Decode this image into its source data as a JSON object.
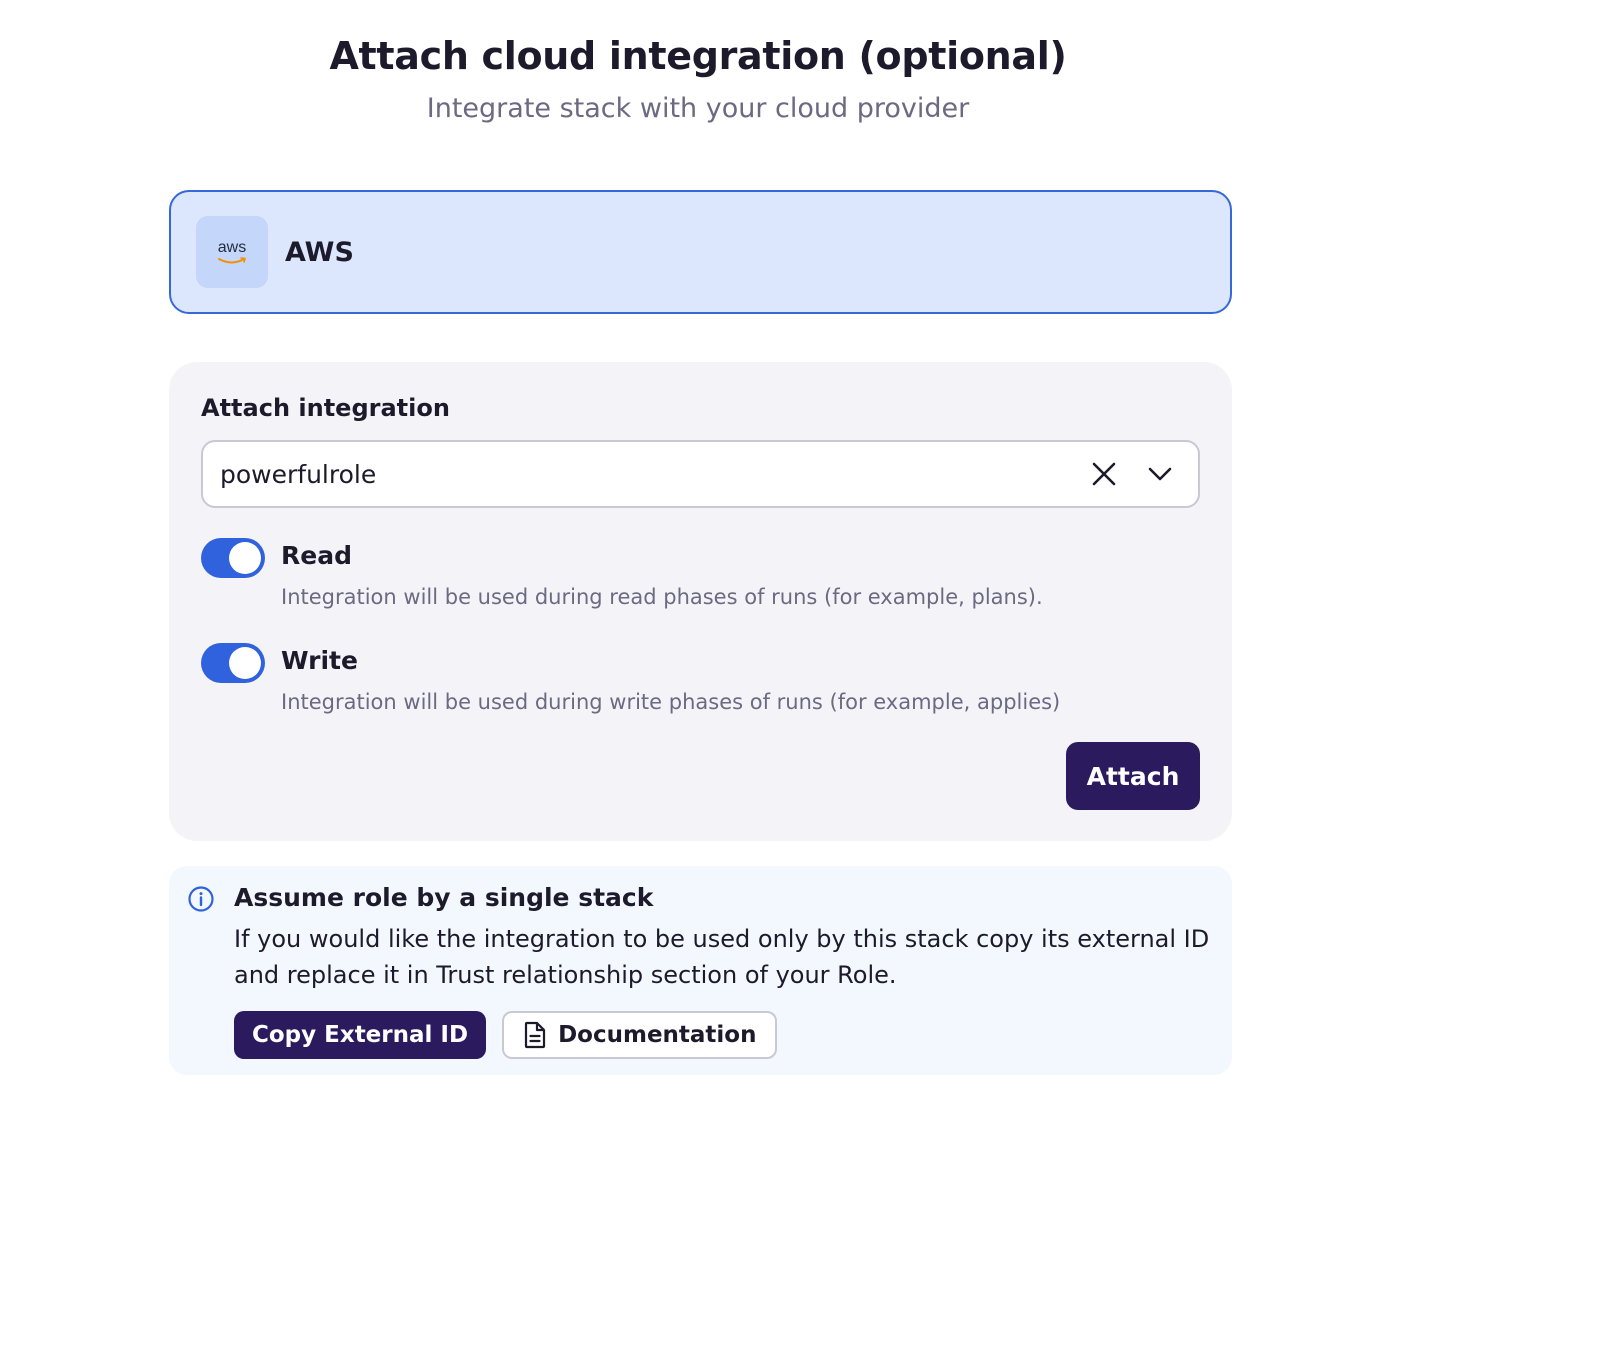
{
  "header": {
    "title": "Attach cloud integration (optional)",
    "subtitle": "Integrate stack with your cloud provider"
  },
  "provider": {
    "logo_text": "aws",
    "name": "AWS",
    "selected": true,
    "icon": "aws-logo-icon"
  },
  "attach_form": {
    "label": "Attach integration",
    "selected_value": "powerfulrole",
    "clear_icon": "close-icon",
    "dropdown_icon": "chevron-down-icon",
    "toggles": [
      {
        "title": "Read",
        "description": "Integration will be used during read phases of runs (for example, plans).",
        "enabled": true
      },
      {
        "title": "Write",
        "description": "Integration will be used during write phases of runs (for example, applies)",
        "enabled": true
      }
    ],
    "submit_label": "Attach"
  },
  "info": {
    "icon": "info-icon",
    "title": "Assume role by a single stack",
    "text": "If you would like the integration to be used only by this stack copy its external ID and replace it in Trust relationship section of your Role.",
    "copy_label": "Copy External ID",
    "doc_label": "Documentation",
    "doc_icon": "document-icon"
  },
  "colors": {
    "accent": "#2f62dc",
    "primary_button": "#2b1a5e",
    "selected_card_bg": "#dce7fd",
    "selected_card_border": "#3569d8"
  }
}
